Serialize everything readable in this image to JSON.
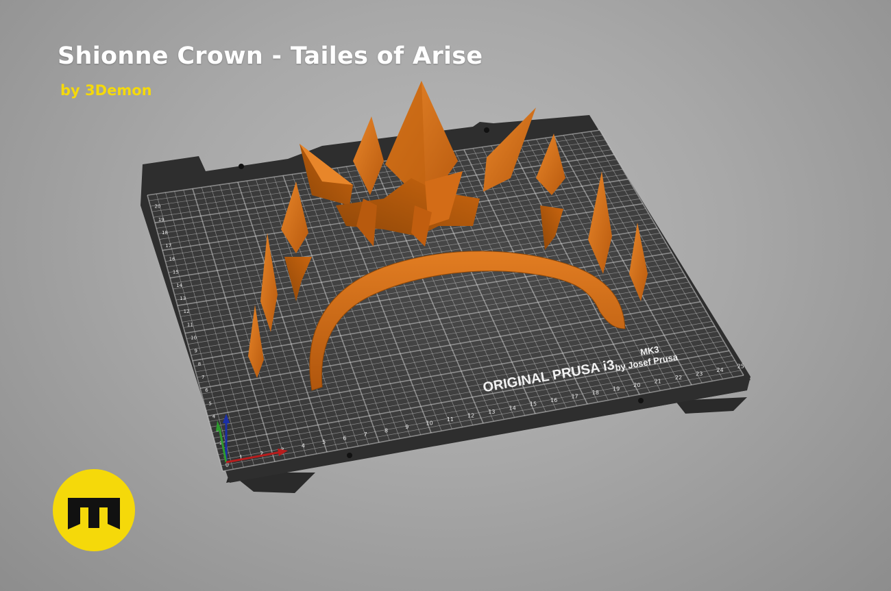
{
  "header": {
    "title": "Shionne Crown - Tailes of Arise",
    "subtitle": "by 3Demon"
  },
  "bed": {
    "brand_line1": "ORIGINAL PRUSA i3",
    "brand_model": "MK3",
    "brand_line2": "by Josef Prusa",
    "x_ticks": [
      "1",
      "2",
      "3",
      "4",
      "5",
      "6",
      "7",
      "8",
      "9",
      "10",
      "11",
      "12",
      "13",
      "14",
      "15",
      "16",
      "17",
      "18",
      "19",
      "20",
      "21",
      "22",
      "23",
      "24",
      "25"
    ],
    "y_ticks": [
      "1",
      "2",
      "3",
      "4",
      "5",
      "6",
      "7",
      "8",
      "9",
      "10",
      "11",
      "12",
      "13",
      "14",
      "15",
      "16",
      "17",
      "18",
      "19",
      "20"
    ],
    "origin_label": "0"
  },
  "logo": {
    "icon": "3demon-logo-icon"
  },
  "colors": {
    "background": "#a8a8a8",
    "title": "#ffffff",
    "subtitle": "#f5d90a",
    "bed_frame": "#2b2b2b",
    "bed_surface": "#3f3f3f",
    "grid": "#d9d9d9",
    "model": "#d9731a",
    "logo_bg": "#f5d90a"
  }
}
